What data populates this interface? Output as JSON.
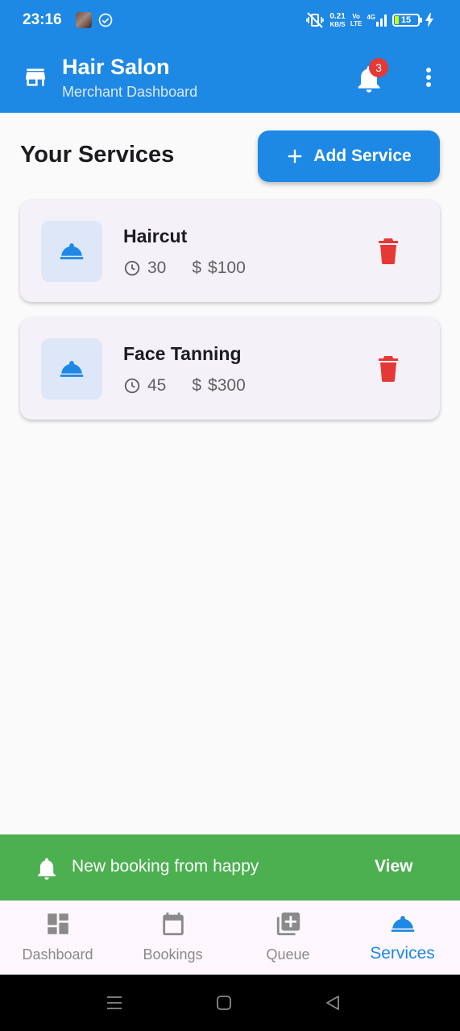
{
  "status_bar": {
    "time": "23:16",
    "net_speed": "0.21",
    "net_unit": "KB/S",
    "volte_top": "Vo",
    "volte_bottom": "LTE",
    "network": "4G",
    "battery": "15"
  },
  "app_bar": {
    "title": "Hair Salon",
    "subtitle": "Merchant Dashboard",
    "notification_count": "3",
    "icons": [
      "store-icon",
      "bell-icon",
      "more-vert-icon"
    ]
  },
  "services_section": {
    "title": "Your Services",
    "add_button_label": "Add Service"
  },
  "services": [
    {
      "name": "Haircut",
      "duration": "30",
      "price_sign": "$",
      "price": "$100"
    },
    {
      "name": "Face Tanning",
      "duration": "45",
      "price_sign": "$",
      "price": "$300"
    }
  ],
  "snackbar": {
    "message": "New booking from happy",
    "action": "View"
  },
  "bottom_nav": {
    "items": [
      {
        "label": "Dashboard",
        "icon": "dashboard-icon",
        "active": false
      },
      {
        "label": "Bookings",
        "icon": "calendar-icon",
        "active": false
      },
      {
        "label": "Queue",
        "icon": "queue-add-icon",
        "active": false
      },
      {
        "label": "Services",
        "icon": "room-service-icon",
        "active": true
      }
    ]
  },
  "colors": {
    "primary": "#1e88e5",
    "danger": "#e53935",
    "snackbar": "#4caf50",
    "nav_inactive": "#8a8a8a"
  }
}
